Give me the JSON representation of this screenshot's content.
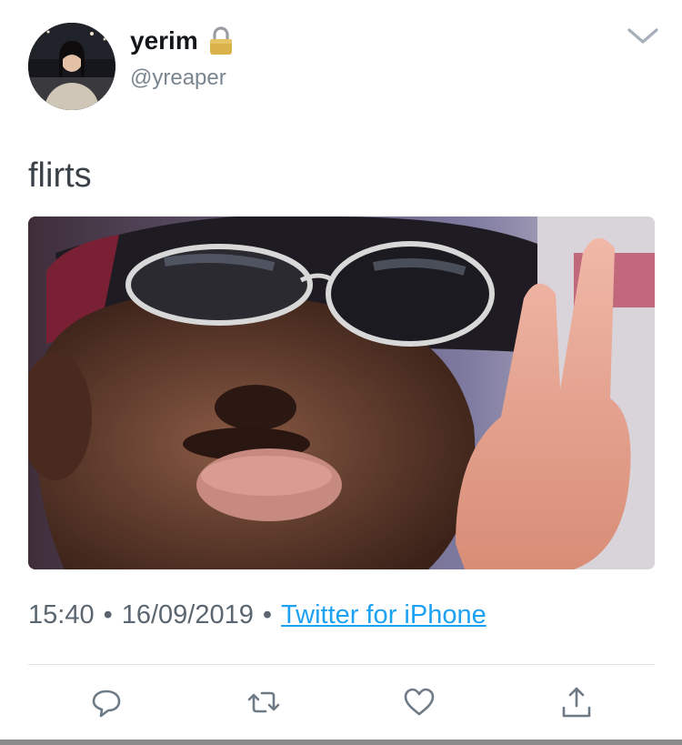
{
  "user": {
    "display_name": "yerim",
    "handle": "@yreaper",
    "protected_icon": "lock-icon"
  },
  "tweet": {
    "text": "flirts",
    "time": "15:40",
    "date": "16/09/2019",
    "source": "Twitter for iPhone",
    "separator": "•"
  },
  "icons": {
    "menu": "chevron-down-icon",
    "reply": "reply-icon",
    "retweet": "retweet-icon",
    "like": "heart-icon",
    "share": "share-icon"
  },
  "colors": {
    "link": "#1da1f2",
    "meta_text": "#5b6670",
    "icon": "#6e7a85"
  }
}
